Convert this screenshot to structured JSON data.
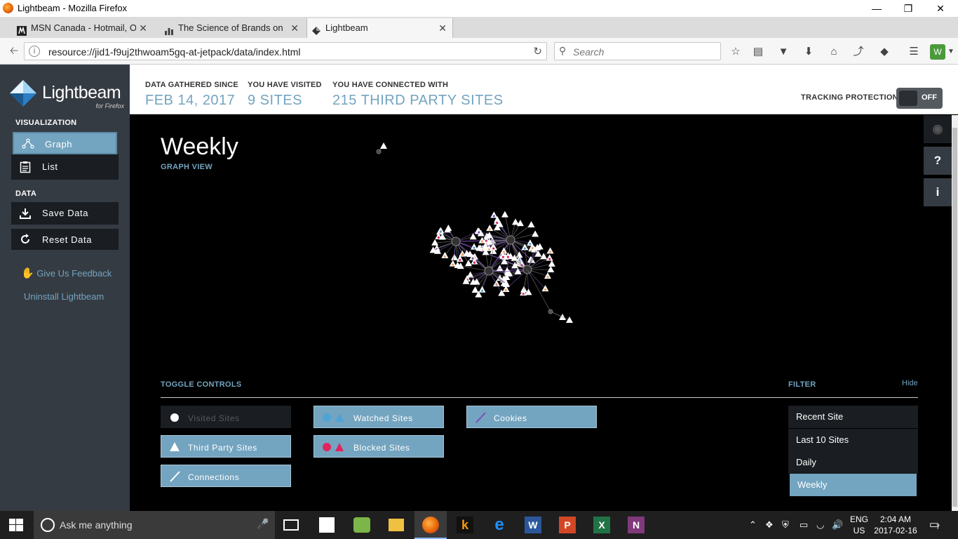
{
  "window": {
    "title": "Lightbeam - Mozilla Firefox"
  },
  "tabs": [
    {
      "label": "MSN Canada - Hotmail, O...",
      "icon": "msn-icon"
    },
    {
      "label": "The Science of Brands on l...",
      "icon": "chart-icon"
    },
    {
      "label": "Lightbeam",
      "icon": "lightbeam-icon",
      "active": true
    }
  ],
  "navbar": {
    "url": "resource://jid1-f9uj2thwoam5gq-at-jetpack/data/index.html",
    "search_placeholder": "Search"
  },
  "sidebar": {
    "logo_name": "Lightbeam",
    "logo_sub": "for Firefox",
    "visualization_label": "VISUALIZATION",
    "viz_items": [
      {
        "label": "Graph",
        "icon": "graph-icon",
        "active": true
      },
      {
        "label": "List",
        "icon": "clipboard-icon",
        "active": false
      }
    ],
    "data_label": "DATA",
    "data_items": [
      {
        "label": "Save Data",
        "icon": "download-icon"
      },
      {
        "label": "Reset Data",
        "icon": "refresh-icon"
      }
    ],
    "feedback": "Give Us Feedback",
    "uninstall": "Uninstall Lightbeam"
  },
  "header": {
    "stats": [
      {
        "label": "DATA GATHERED SINCE",
        "value": "FEB 14, 2017"
      },
      {
        "label": "YOU HAVE VISITED",
        "value": "9 SITES"
      },
      {
        "label": "YOU HAVE CONNECTED WITH",
        "value": "215 THIRD PARTY SITES"
      }
    ],
    "tracking_label": "TRACKING PROTECTION",
    "tracking_state": "OFF"
  },
  "main": {
    "title": "Weekly",
    "subtitle": "GRAPH VIEW",
    "toggle_title": "TOGGLE CONTROLS",
    "filter_title": "FILTER",
    "filter_hide": "Hide",
    "toggles": [
      {
        "label": "Visited Sites",
        "on": false
      },
      {
        "label": "Watched Sites",
        "on": true
      },
      {
        "label": "Cookies",
        "on": true
      },
      {
        "label": "Third Party Sites",
        "on": true
      },
      {
        "label": "Blocked Sites",
        "on": true
      },
      {
        "label": "Connections",
        "on": true
      }
    ],
    "filters": [
      {
        "label": "Recent Site",
        "active": false
      },
      {
        "label": "Last 10 Sites",
        "active": false
      },
      {
        "label": "Daily",
        "active": false
      },
      {
        "label": "Weekly",
        "active": true
      }
    ]
  },
  "taskbar": {
    "search_placeholder": "Ask me anything",
    "lang_1": "ENG",
    "lang_2": "US",
    "time": "2:04 AM",
    "date": "2017-02-16",
    "notifications": "7"
  },
  "colors": {
    "accent": "#73a4c0",
    "sidebar_bg": "#353b42",
    "button_dark": "#1a1d21",
    "watched": "#4fa3d6",
    "blocked": "#e0245e",
    "cookie_line": "#7b4fb8"
  }
}
